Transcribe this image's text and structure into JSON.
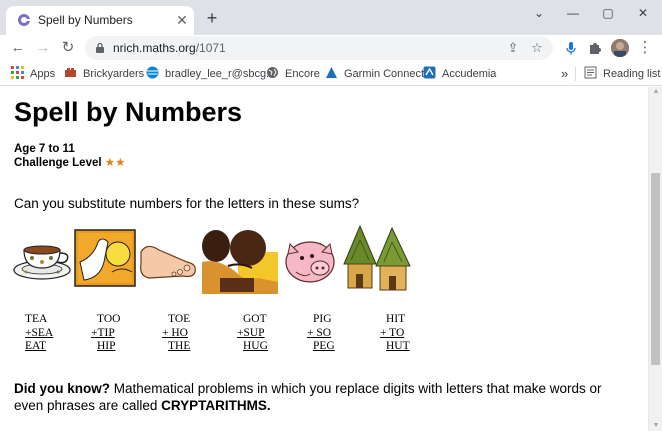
{
  "browser": {
    "tab_title": "Spell by Numbers",
    "tab_close": "✕",
    "new_tab": "+",
    "url_host": "nrich.maths.org",
    "url_path": "/1071",
    "bookmarks": [
      {
        "label": "Apps",
        "icon": "apps-grid-icon"
      },
      {
        "label": "Brickyarders",
        "icon": "brick-icon"
      },
      {
        "label": "bradley_lee_r@sbcg...",
        "icon": "att-icon"
      },
      {
        "label": "Encore",
        "icon": "globe-icon"
      },
      {
        "label": "Garmin Connect",
        "icon": "garmin-icon"
      },
      {
        "label": "Accudemia",
        "icon": "accudemia-icon"
      }
    ],
    "overflow_label": "»",
    "reading_list_label": "Reading list",
    "accent_color": "#1a73e8"
  },
  "page": {
    "title": "Spell by Numbers",
    "age": "Age 7 to 11",
    "challenge_label": "Challenge Level",
    "challenge_stars": "★★",
    "question": "Can you substitute numbers for the letters in these sums?",
    "pictures": [
      "tea-cup",
      "toe-foot-xray",
      "foot-toe",
      "hug-couple",
      "pig",
      "huts"
    ],
    "sums": [
      {
        "line1": "TEA",
        "line2": "+SEA",
        "line3": " EAT"
      },
      {
        "line1": "TOO",
        "line2": "+TIP",
        "line3": " HIP"
      },
      {
        "line1": "TOE",
        "line2": "+ HO",
        "line3": " THE"
      },
      {
        "line1": "GOT",
        "line2": "+SUP",
        "line3": " HUG"
      },
      {
        "line1": "PIG",
        "line2": "+ SO",
        "line3": " PEG"
      },
      {
        "line1": "HIT",
        "line2": "+ TO",
        "line3": " HUT"
      }
    ],
    "did_you_know_lead": "Did you know?",
    "did_you_know_text": "Mathematical problems in which you replace digits with letters that make words or even phrases are called",
    "did_you_know_term": "CRYPTARITHMS."
  }
}
